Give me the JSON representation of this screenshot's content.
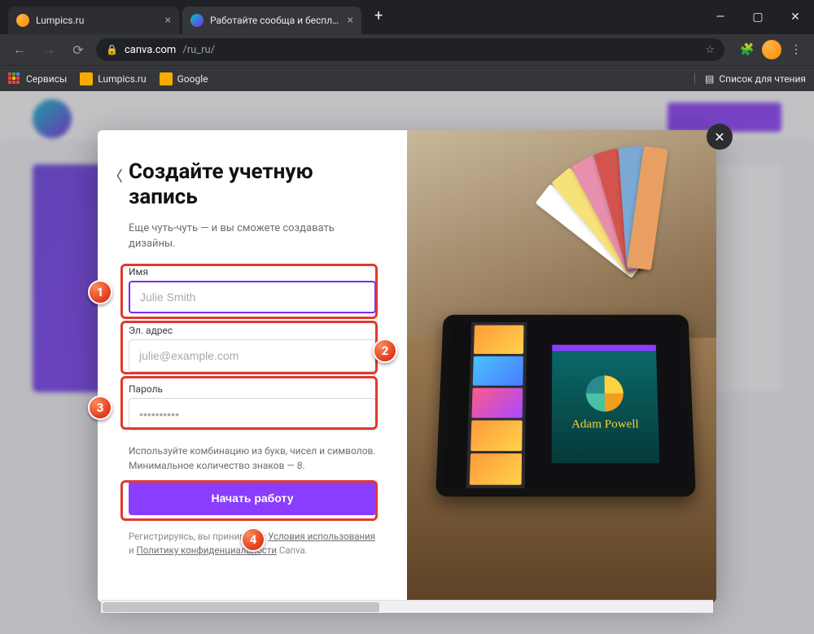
{
  "browser": {
    "tabs": [
      {
        "title": "Lumpics.ru",
        "active": false
      },
      {
        "title": "Работайте сообща и бесплатно",
        "active": true
      }
    ],
    "url_host": "canva.com",
    "url_path": "/ru_ru/",
    "bookmarks": {
      "apps": "Сервисы",
      "items": [
        "Lumpics.ru",
        "Google"
      ],
      "reading_list": "Список для чтения"
    }
  },
  "modal": {
    "title": "Создайте учетную запись",
    "subtitle": "Еще чуть-чуть — и вы сможете создавать дизайны.",
    "fields": {
      "name": {
        "label": "Имя",
        "placeholder": "Julie Smith",
        "value": ""
      },
      "email": {
        "label": "Эл. адрес",
        "placeholder": "julie@example.com",
        "value": ""
      },
      "password": {
        "label": "Пароль",
        "placeholder": "••••••••••",
        "value": ""
      }
    },
    "password_hint": "Используйте комбинацию из букв, чисел и символов. Минимальное количество знаков — 8.",
    "cta": "Начать работу",
    "legal": {
      "prefix": "Регистрируясь, вы принимаете ",
      "tos": "Условия использования",
      "and": " и ",
      "privacy": "Политику конфиденциальности",
      "suffix": " Canva."
    },
    "poster_name": "Adam Powell"
  },
  "annotations": {
    "n1": "1",
    "n2": "2",
    "n3": "3",
    "n4": "4"
  }
}
